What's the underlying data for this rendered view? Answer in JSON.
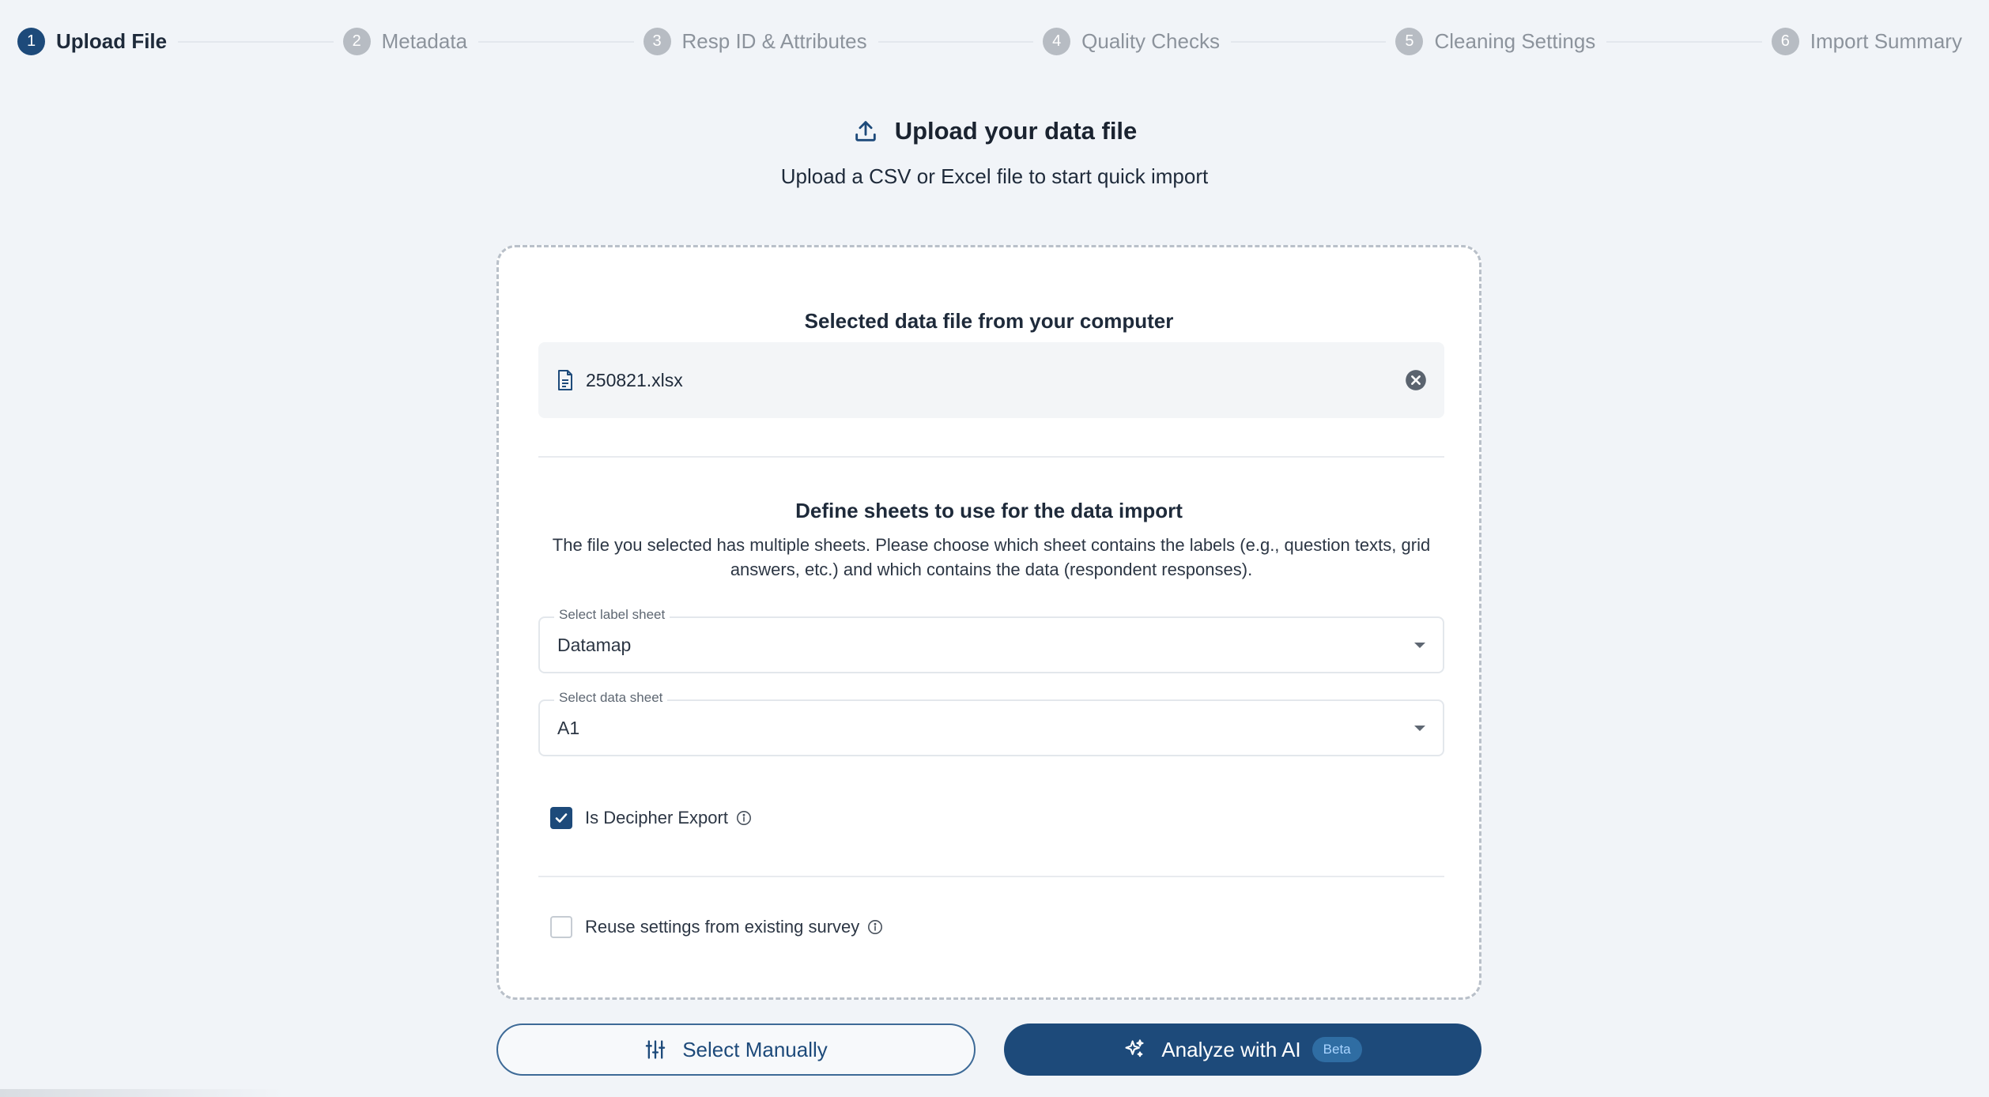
{
  "stepper": {
    "steps": [
      {
        "num": "1",
        "label": "Upload File"
      },
      {
        "num": "2",
        "label": "Metadata"
      },
      {
        "num": "3",
        "label": "Resp ID & Attributes"
      },
      {
        "num": "4",
        "label": "Quality Checks"
      },
      {
        "num": "5",
        "label": "Cleaning Settings"
      },
      {
        "num": "6",
        "label": "Import Summary"
      }
    ],
    "active_step": 1
  },
  "header": {
    "title": "Upload your data file",
    "subtitle": "Upload a CSV or Excel file to start quick import"
  },
  "file_section": {
    "title": "Selected data file from your computer",
    "file_name": "250821.xlsx"
  },
  "sheets_section": {
    "title": "Define sheets to use for the data import",
    "description": "The file you selected has multiple sheets. Please choose which sheet contains the labels (e.g., question texts, grid answers, etc.) and which contains the data (respondent responses).",
    "label_sheet": {
      "label": "Select label sheet",
      "value": "Datamap"
    },
    "data_sheet": {
      "label": "Select data sheet",
      "value": "A1"
    }
  },
  "options": {
    "decipher_export": {
      "label": "Is Decipher Export",
      "checked": true
    },
    "reuse_settings": {
      "label": "Reuse settings from existing survey",
      "checked": false
    }
  },
  "actions": {
    "select_manually": "Select Manually",
    "analyze_ai": "Analyze with AI",
    "beta_badge": "Beta"
  },
  "colors": {
    "primary": "#1d4a7a",
    "background": "#f1f4f8",
    "inactive_step": "#b7bcc3"
  }
}
